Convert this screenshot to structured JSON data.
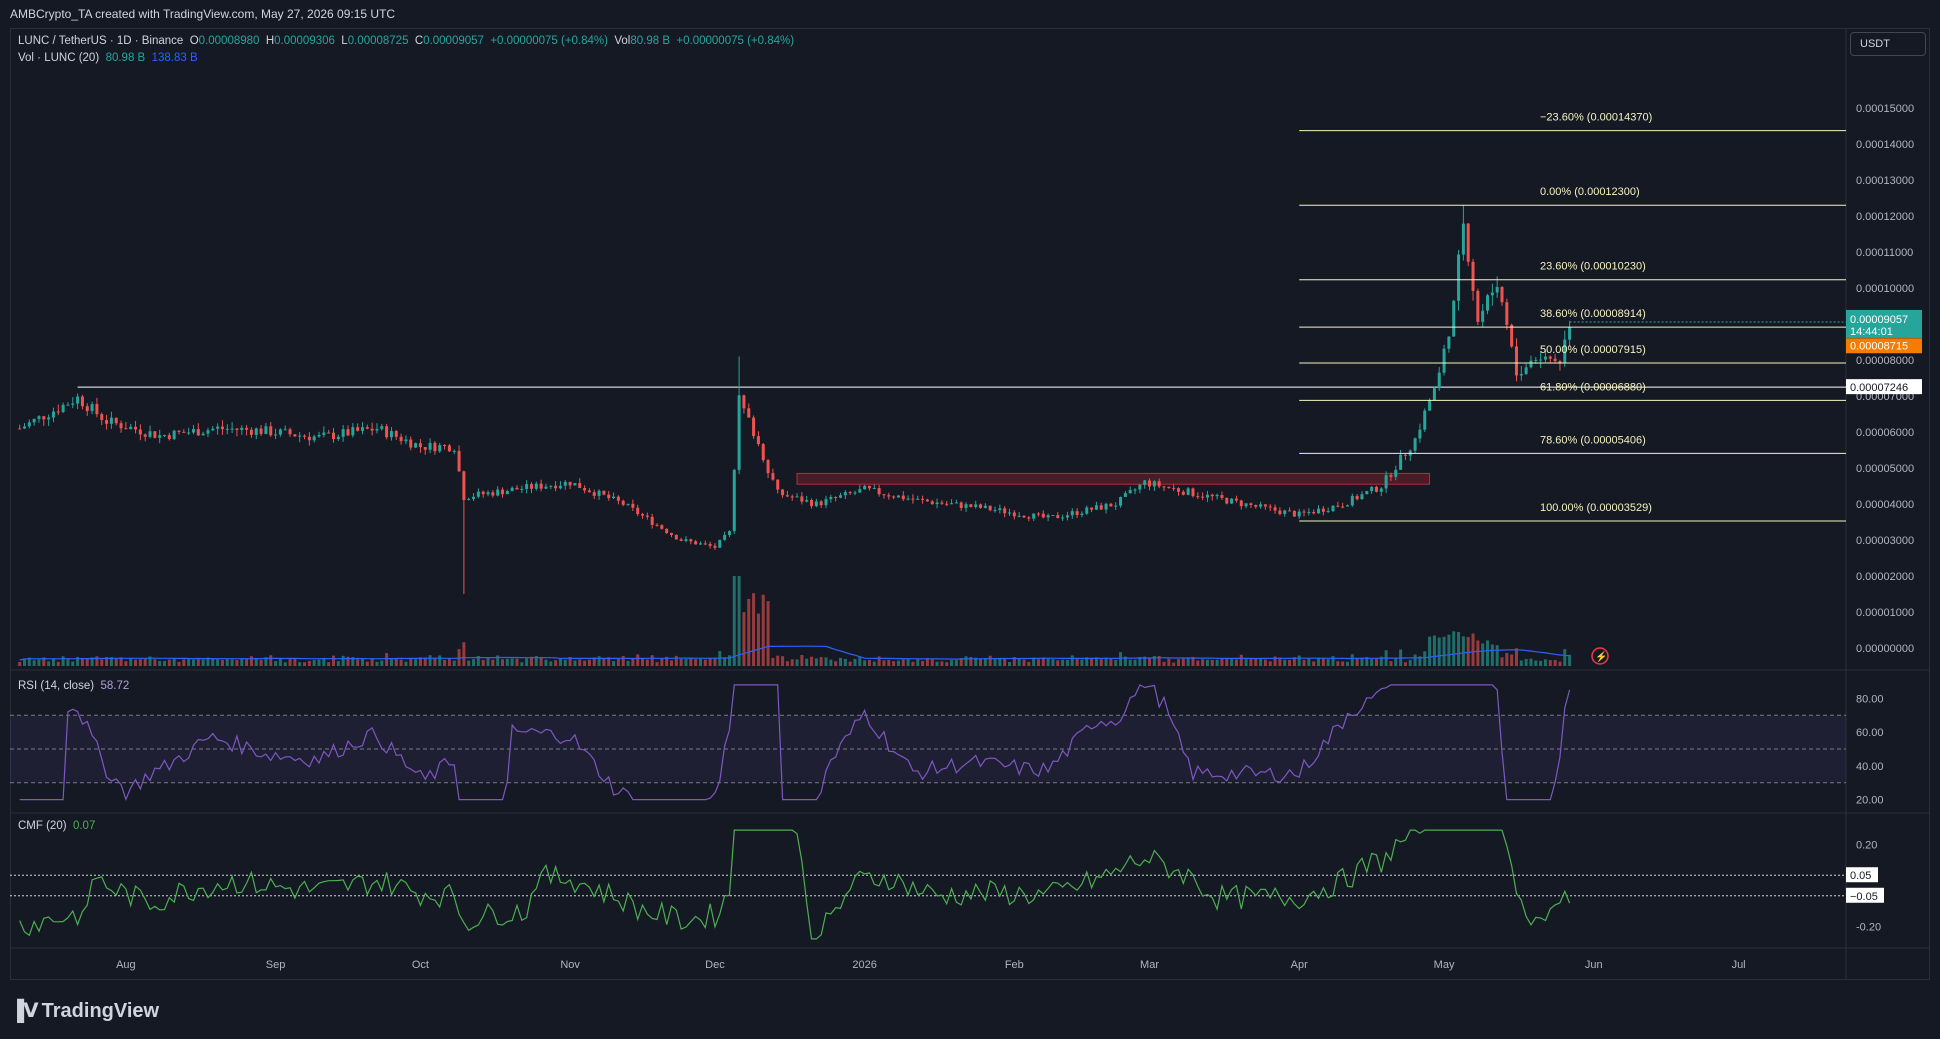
{
  "header": {
    "attribution": "AMBCrypto_TA created with TradingView.com, May 27, 2026 09:15 UTC"
  },
  "legend": {
    "symbol": "LUNC / TetherUS · 1D · Binance",
    "open_label": "O",
    "open": "0.00008980",
    "high_label": "H",
    "high": "0.00009306",
    "low_label": "L",
    "low": "0.00008725",
    "close_label": "C",
    "close": "0.00009057",
    "change": "+0.00000075 (+0.84%)",
    "vol_label": "Vol",
    "vol": "80.98 B",
    "vol_change": "+0.00000075 (+0.84%)",
    "volume_indicator": "Vol · LUNC (20)",
    "volume_value": "80.98 B",
    "volume_ma": "138.83 B"
  },
  "quote_currency": "USDT",
  "price_axis": {
    "ticks": [
      "0.00015000",
      "0.00014000",
      "0.00013000",
      "0.00012000",
      "0.00011000",
      "0.00010000",
      "0.00009000",
      "0.00008000",
      "0.00007000",
      "0.00006000",
      "0.00005000",
      "0.00004000",
      "0.00003000",
      "0.00002000",
      "0.00001000",
      "0.00000000"
    ],
    "last_price": "0.00009057",
    "countdown": "14:44:01",
    "orange_label": "0.00008715",
    "white_label": "0.00007246"
  },
  "time_axis": [
    "Aug",
    "Sep",
    "Oct",
    "Nov",
    "Dec",
    "2026",
    "Feb",
    "Mar",
    "Apr",
    "May",
    "Jun",
    "Jul"
  ],
  "fib_levels": [
    {
      "label": "−23.60% (0.00014370)",
      "price": 0.0001437
    },
    {
      "label": "0.00% (0.00012300)",
      "price": 0.000123
    },
    {
      "label": "23.60% (0.00010230)",
      "price": 0.0001023
    },
    {
      "label": "38.60% (0.00008914)",
      "price": 8.914e-05
    },
    {
      "label": "50.00% (0.00007915)",
      "price": 7.915e-05
    },
    {
      "label": "61.80% (0.00006880)",
      "price": 6.88e-05
    },
    {
      "label": "78.60% (0.00005406)",
      "price": 5.406e-05
    },
    {
      "label": "100.00% (0.00003529)",
      "price": 3.529e-05
    }
  ],
  "rsi": {
    "label": "RSI (14, close)",
    "value": "58.72",
    "ticks": [
      "80.00",
      "60.00",
      "40.00",
      "20.00"
    ]
  },
  "cmf": {
    "label": "CMF (20)",
    "value": "0.07",
    "ticks": [
      "0.20",
      "-0.20"
    ],
    "level_labels": [
      "0.05",
      "−0.05"
    ]
  },
  "brand": {
    "name": "TradingView"
  },
  "colors": {
    "background": "#151924",
    "bull": "#26a69a",
    "bear": "#ef5350",
    "rsi_line": "#7e57c2",
    "cmf_line": "#4caf50",
    "volume_ma": "#2962ff",
    "fib": "#f5f3c0",
    "orange": "#f57c00"
  },
  "chart_data": {
    "type": "candlestick",
    "series_name": "LUNC / TetherUS",
    "control_points": [
      [
        "2025-07-10",
        6.1e-05
      ],
      [
        "2025-07-22",
        6.95e-05
      ],
      [
        "2025-07-28",
        6.3e-05
      ],
      [
        "2025-08-08",
        5.9e-05
      ],
      [
        "2025-08-20",
        6.1e-05
      ],
      [
        "2025-08-28",
        6.05e-05
      ],
      [
        "2025-09-10",
        5.85e-05
      ],
      [
        "2025-09-22",
        6.1e-05
      ],
      [
        "2025-10-01",
        5.6e-05
      ],
      [
        "2025-10-08",
        5.6e-05
      ],
      [
        "2025-10-10",
        4.2e-05
      ],
      [
        "2025-10-20",
        4.4e-05
      ],
      [
        "2025-11-01",
        4.6e-05
      ],
      [
        "2025-11-12",
        4e-05
      ],
      [
        "2025-11-24",
        3e-05
      ],
      [
        "2025-12-01",
        2.8e-05
      ],
      [
        "2025-12-04",
        3.2e-05
      ],
      [
        "2025-12-06",
        6.9e-05
      ],
      [
        "2025-12-09",
        6e-05
      ],
      [
        "2025-12-14",
        4.3e-05
      ],
      [
        "2025-12-22",
        4e-05
      ],
      [
        "2026-01-01",
        4.4e-05
      ],
      [
        "2026-01-12",
        4.1e-05
      ],
      [
        "2026-01-25",
        3.9e-05
      ],
      [
        "2026-02-08",
        3.6e-05
      ],
      [
        "2026-02-22",
        4e-05
      ],
      [
        "2026-02-28",
        4.6e-05
      ],
      [
        "2026-03-10",
        4.3e-05
      ],
      [
        "2026-03-24",
        3.9e-05
      ],
      [
        "2026-04-01",
        3.7e-05
      ],
      [
        "2026-04-10",
        4e-05
      ],
      [
        "2026-04-18",
        4.5e-05
      ],
      [
        "2026-04-25",
        5.8e-05
      ],
      [
        "2026-04-30",
        7.6e-05
      ],
      [
        "2026-05-03",
        9.5e-05
      ],
      [
        "2026-05-05",
        0.000119
      ],
      [
        "2026-05-08",
        9.1e-05
      ],
      [
        "2026-05-12",
        0.000102
      ],
      [
        "2026-05-16",
        7.6e-05
      ],
      [
        "2026-05-20",
        8.1e-05
      ],
      [
        "2026-05-25",
        8e-05
      ],
      [
        "2026-05-27",
        9.06e-05
      ]
    ],
    "notable_candles": [
      {
        "date": "2025-10-10",
        "low": 1.5e-05
      },
      {
        "date": "2025-12-06",
        "high": 8.1e-05
      },
      {
        "date": "2026-05-05",
        "high": 0.000123
      }
    ],
    "horizontal_resistance": 7.246e-05,
    "supply_zone": {
      "from": "2025-12-18",
      "to": "2026-04-28",
      "top": 4.85e-05,
      "bottom": 4.55e-05
    },
    "ylim": [
      0.0,
      0.000155
    ],
    "xlim": [
      "2025-07-08",
      "2026-07-22"
    ]
  }
}
